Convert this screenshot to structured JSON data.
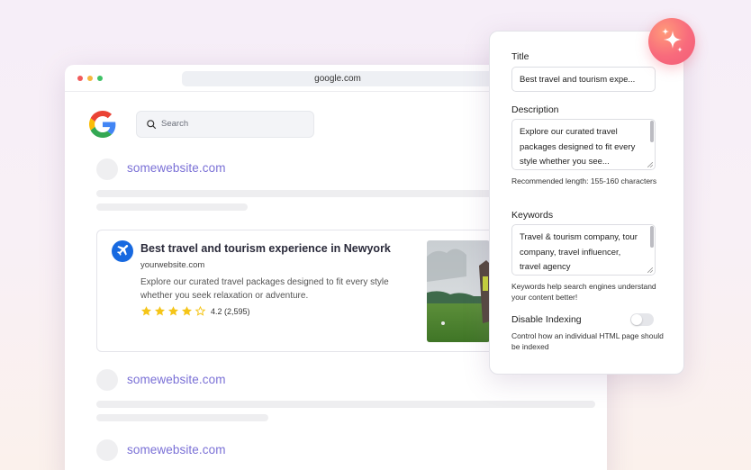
{
  "browser": {
    "url": "google.com",
    "search_placeholder": "Search"
  },
  "results": {
    "site_name": "somewebsite.com",
    "featured": {
      "title": "Best travel and tourism experience in Newyork",
      "url": "yourwebsite.com",
      "description": "Explore our curated travel packages designed to fit every style whether you seek relaxation or adventure.",
      "rating_text": "4.2 (2,595)",
      "rating_value": 4.5,
      "rating_max": 5
    }
  },
  "panel": {
    "title_label": "Title",
    "title_value": "Best travel and tourism expe...",
    "description_label": "Description",
    "description_value": "Explore our curated travel packages designed to fit every style whether you see...",
    "description_hint": "Recommended length: 155-160 characters",
    "keywords_label": "Keywords",
    "keywords_value": "Travel & tourism company, tour company, travel influencer, travel agency",
    "keywords_hint": "Keywords help search engines understand your content better!",
    "indexing_label": "Disable Indexing",
    "indexing_enabled": false,
    "indexing_hint": "Control how an individual HTML page should be indexed"
  },
  "colors": {
    "accent": "#7a70d6",
    "plane_badge": "#1769e0",
    "star": "#f5c518",
    "sparkle_start": "#ff9a7a",
    "sparkle_end": "#f25c78"
  },
  "icons": {
    "search": "search-icon",
    "plane": "airplane-icon",
    "sparkle": "sparkle-icon",
    "logo": "google-logo-icon"
  }
}
